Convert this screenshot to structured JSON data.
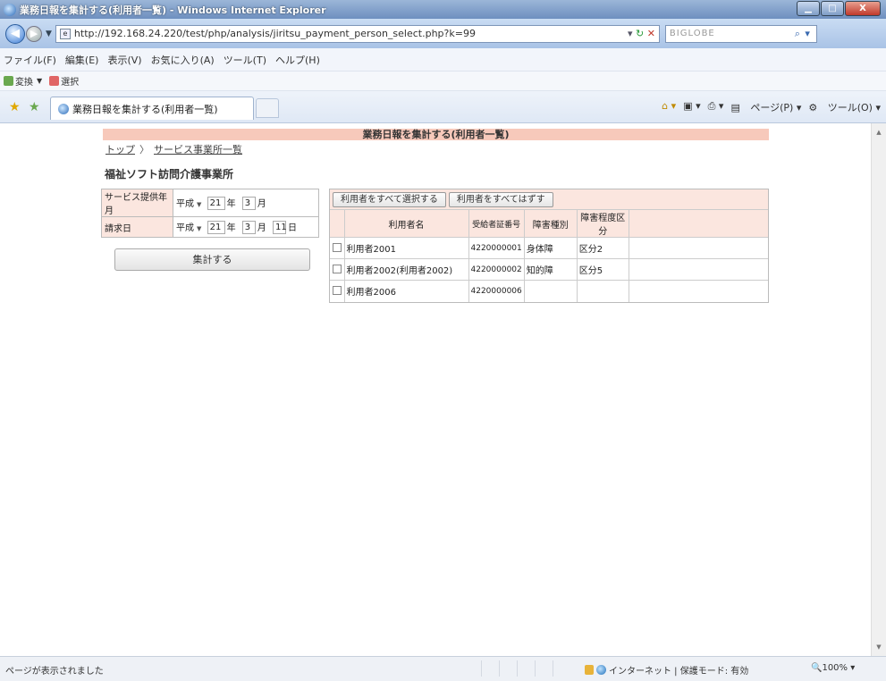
{
  "window": {
    "title": "業務日報を集計する(利用者一覧) - Windows Internet Explorer",
    "minimize": "▁",
    "maximize": "□",
    "close": "X"
  },
  "address": {
    "url": "http://192.168.24.220/test/php/analysis/jiritsu_payment_person_select.php?k=99",
    "search_text": "BIGLOBE"
  },
  "menu": [
    "ファイル(F)",
    "編集(E)",
    "表示(V)",
    "お気に入り(A)",
    "ツール(T)",
    "ヘルプ(H)"
  ],
  "toolbar": {
    "convert": "変換",
    "select": "選択"
  },
  "tab": {
    "label": "業務日報を集計する(利用者一覧)"
  },
  "command_bar": {
    "page": "ページ(P)",
    "tools": "ツール(O)"
  },
  "page": {
    "header": "業務日報を集計する(利用者一覧)",
    "breadcrumb": {
      "top": "トップ",
      "separator": "〉",
      "offices": "サービス事業所一覧"
    },
    "office_name": "福祉ソフト訪問介護事業所"
  },
  "form": {
    "service_month": {
      "label": "サービス提供年月",
      "era": "平成",
      "year": "21",
      "year_unit": "年",
      "month": "3",
      "month_unit": "月"
    },
    "billing_date": {
      "label": "請求日",
      "era": "平成",
      "year": "21",
      "year_unit": "年",
      "month": "3",
      "month_unit": "月",
      "day": "11",
      "day_unit": "日"
    },
    "aggregate_button": "集計する"
  },
  "users_panel": {
    "select_all": "利用者をすべて選択する",
    "deselect_all": "利用者をすべてはずす",
    "columns": {
      "name": "利用者名",
      "number": "受給者証番号",
      "disability_type": "障害種別",
      "disability_degree": "障害程度区分"
    },
    "rows": [
      {
        "name": "利用者2001",
        "number": "4220000001",
        "type": "身体障",
        "degree": "区分2"
      },
      {
        "name": "利用者2002(利用者2002)",
        "number": "4220000002",
        "type": "知的障",
        "degree": "区分5"
      },
      {
        "name": "利用者2006",
        "number": "4220000006",
        "type": "",
        "degree": ""
      }
    ]
  },
  "status": {
    "text": "ページが表示されました",
    "zone": "インターネット | 保護モード: 有効",
    "zoom": "100%"
  }
}
